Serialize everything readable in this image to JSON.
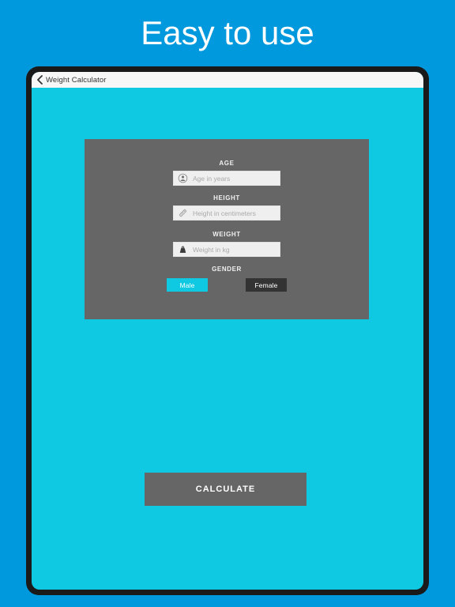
{
  "promo": {
    "headline": "Easy to use"
  },
  "device": {
    "navbar": {
      "back_icon": "chevron-left-icon",
      "title": "Weight Calculator"
    },
    "colors": {
      "page_background": "#0099dd",
      "device_frame": "#1a1a1a",
      "app_background": "#0fc9e2",
      "card_background": "#666666",
      "navbar_background": "#f7f7f7",
      "accent": "#0fc9e2",
      "unselected": "#333333"
    },
    "form": {
      "fields": [
        {
          "label": "AGE",
          "icon": "person-circle-icon",
          "placeholder": "Age in years",
          "value": ""
        },
        {
          "label": "HEIGHT",
          "icon": "ruler-icon",
          "placeholder": "Height in centimeters",
          "value": ""
        },
        {
          "label": "WEIGHT",
          "icon": "weight-scale-icon",
          "placeholder": "Weight in kg",
          "value": ""
        }
      ],
      "gender": {
        "label": "GENDER",
        "options": [
          {
            "label": "Male",
            "selected": true
          },
          {
            "label": "Female",
            "selected": false
          }
        ]
      }
    },
    "calculate_button": {
      "label": "CALCULATE"
    }
  }
}
